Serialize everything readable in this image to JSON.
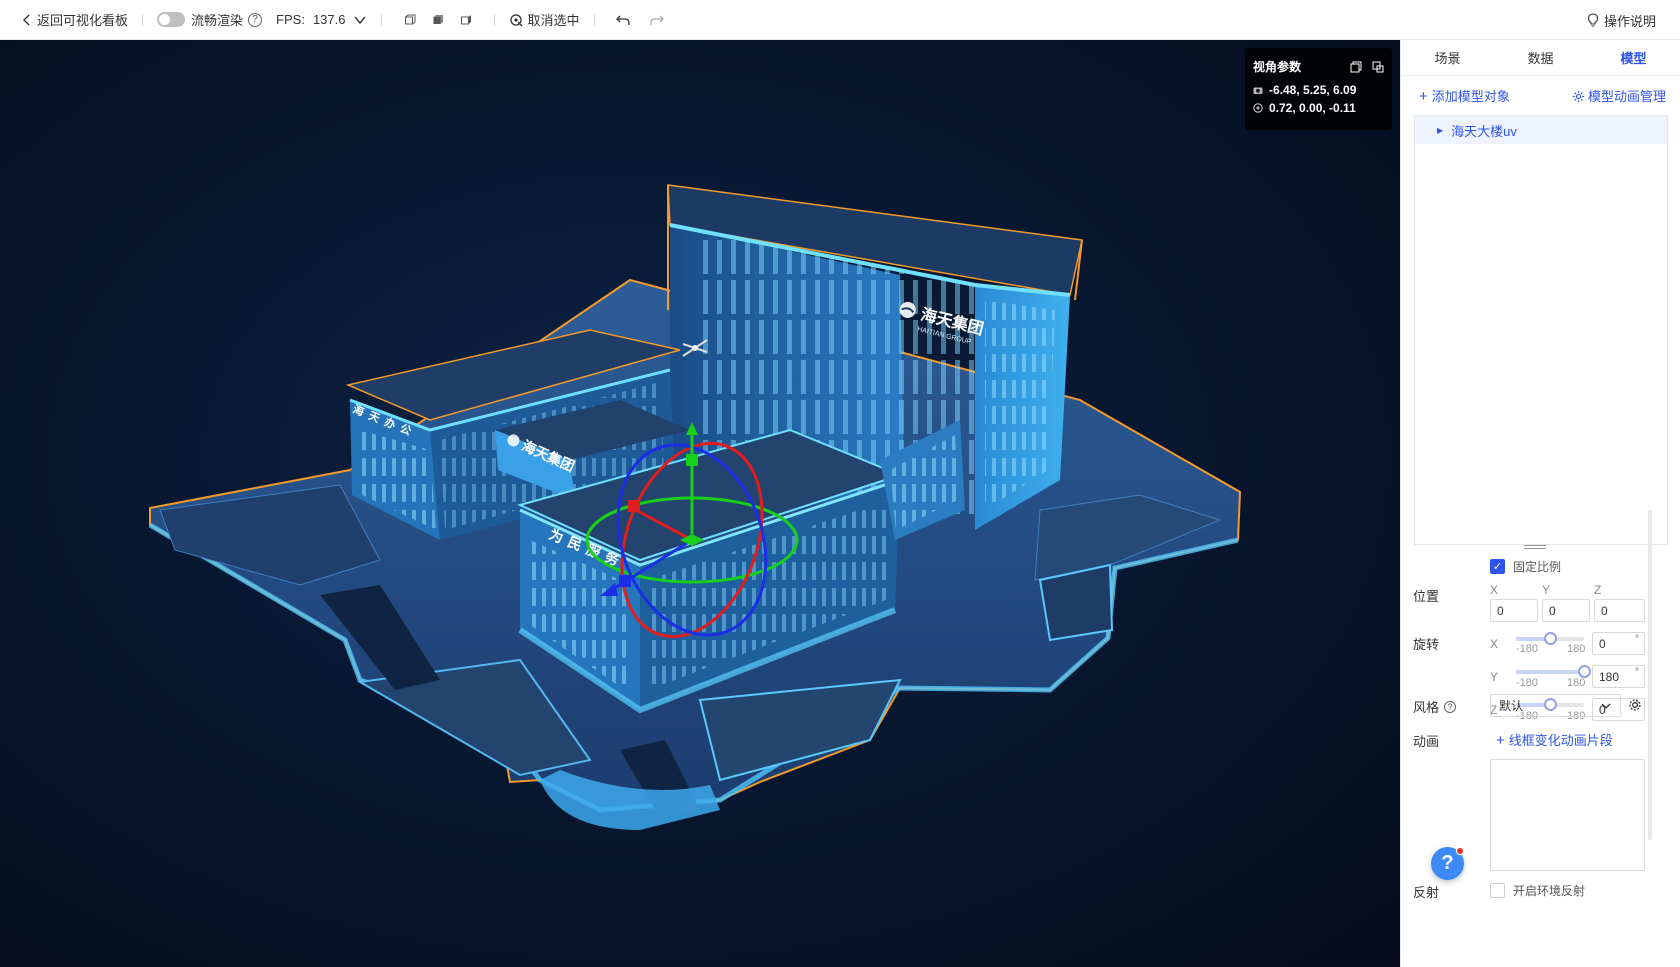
{
  "toolbar": {
    "back_label": "返回可视化看板",
    "smooth_render_label": "流畅渲染",
    "fps_label": "FPS:",
    "fps_value": "137.6",
    "deselect_label": "取消选中",
    "help_label": "操作说明"
  },
  "camera_panel": {
    "title": "视角参数",
    "position": "-6.48, 5.25, 6.09",
    "target": "0.72, 0.00, -0.11"
  },
  "building_signs": {
    "main_cn": "海天集团",
    "main_en": "HAITIAN GROUP",
    "left_wing": "海天办公",
    "bridge": "海天集团",
    "front": "为民服务"
  },
  "panel": {
    "tabs": [
      "场景",
      "数据",
      "模型"
    ],
    "active_tab": "模型",
    "add_model_label": "添加模型对象",
    "anim_manage_label": "模型动画管理",
    "tree_items": [
      "海天大楼uv"
    ],
    "fixed_ratio_label": "固定比例",
    "position_label": "位置",
    "axes": [
      "X",
      "Y",
      "Z"
    ],
    "position_values": [
      "0",
      "0",
      "0"
    ],
    "rotation_label": "旋转",
    "rotation": [
      {
        "axis": "X",
        "min": "-180",
        "max": "180",
        "value": "0",
        "unit": "°"
      },
      {
        "axis": "Y",
        "min": "-180",
        "max": "180",
        "value": "180",
        "unit": "°"
      },
      {
        "axis": "Z",
        "min": "-180",
        "max": "180",
        "value": "0",
        "unit": "°"
      }
    ],
    "style_label": "风格",
    "style_value": "默认",
    "animation_label": "动画",
    "add_anim_label": "线框变化动画片段",
    "reflection_label": "反射",
    "env_reflection_label": "开启环境反射",
    "help_fab": "?"
  },
  "colors": {
    "accent": "#2f54eb",
    "viewport_bg": "#081730",
    "outline": "#f39a2b"
  }
}
